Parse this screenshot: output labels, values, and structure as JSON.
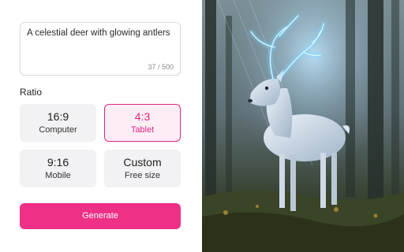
{
  "prompt": {
    "value": "A celestial deer with glowing antlers",
    "char_count": "37 / 500"
  },
  "ratio": {
    "label": "Ratio",
    "options": [
      {
        "ratio": "16:9",
        "name": "Computer",
        "selected": false
      },
      {
        "ratio": "4:3",
        "name": "Tablet",
        "selected": true
      },
      {
        "ratio": "9:16",
        "name": "Mobile",
        "selected": false
      },
      {
        "ratio": "Custom",
        "name": "Free size",
        "selected": false
      }
    ]
  },
  "generate": {
    "label": "Generate"
  },
  "preview": {
    "subject": "celestial deer with glowing blue antlers in a misty forest"
  },
  "colors": {
    "accent": "#ee3086",
    "selected_border": "#e0267f",
    "selected_bg": "#fdeef6",
    "card_bg": "#f2f2f4"
  }
}
